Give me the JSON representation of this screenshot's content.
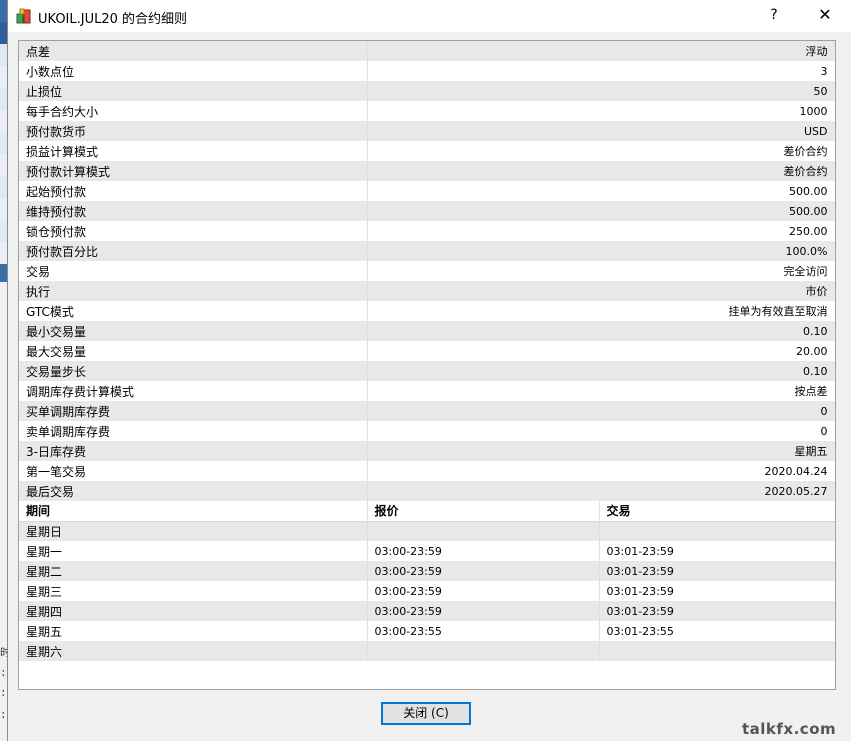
{
  "window": {
    "title": "UKOIL.JUL20 的合约细则",
    "help_label": "?",
    "close_glyph": "✕"
  },
  "properties": [
    {
      "key": "点差",
      "value": "浮动"
    },
    {
      "key": "小数点位",
      "value": "3"
    },
    {
      "key": "止损位",
      "value": "50"
    },
    {
      "key": "每手合约大小",
      "value": "1000"
    },
    {
      "key": "预付款货币",
      "value": "USD"
    },
    {
      "key": "损益计算模式",
      "value": "差价合约"
    },
    {
      "key": "预付款计算模式",
      "value": "差价合约"
    },
    {
      "key": "起始预付款",
      "value": "500.00"
    },
    {
      "key": "维持预付款",
      "value": "500.00"
    },
    {
      "key": "锁仓预付款",
      "value": "250.00"
    },
    {
      "key": "预付款百分比",
      "value": "100.0%"
    },
    {
      "key": "交易",
      "value": "完全访问"
    },
    {
      "key": "执行",
      "value": "市价"
    },
    {
      "key": "GTC模式",
      "value": "挂单为有效直至取消"
    },
    {
      "key": "最小交易量",
      "value": "0.10"
    },
    {
      "key": "最大交易量",
      "value": "20.00"
    },
    {
      "key": "交易量步长",
      "value": "0.10"
    },
    {
      "key": "调期库存费计算模式",
      "value": "按点差"
    },
    {
      "key": "买单调期库存费",
      "value": "0"
    },
    {
      "key": "卖单调期库存费",
      "value": "0"
    },
    {
      "key": "3-日库存费",
      "value": "星期五"
    },
    {
      "key": "第一笔交易",
      "value": "2020.04.24"
    },
    {
      "key": "最后交易",
      "value": "2020.05.27"
    }
  ],
  "sessions": {
    "headers": [
      "期间",
      "报价",
      "交易"
    ],
    "rows": [
      {
        "day": "星期日",
        "quote": "",
        "trade": ""
      },
      {
        "day": "星期一",
        "quote": "03:00-23:59",
        "trade": "03:01-23:59"
      },
      {
        "day": "星期二",
        "quote": "03:00-23:59",
        "trade": "03:01-23:59"
      },
      {
        "day": "星期三",
        "quote": "03:00-23:59",
        "trade": "03:01-23:59"
      },
      {
        "day": "星期四",
        "quote": "03:00-23:59",
        "trade": "03:01-23:59"
      },
      {
        "day": "星期五",
        "quote": "03:00-23:55",
        "trade": "03:01-23:55"
      },
      {
        "day": "星期六",
        "quote": "",
        "trade": ""
      }
    ]
  },
  "footer": {
    "close_button_label": "关闭 (C)"
  },
  "background": {
    "fragments": [
      "时",
      ":5",
      ":3",
      ":"
    ]
  },
  "watermark": "talkfx.com",
  "colors": {
    "row_alt": "#e8e8e8",
    "button_border": "#0078d7"
  }
}
